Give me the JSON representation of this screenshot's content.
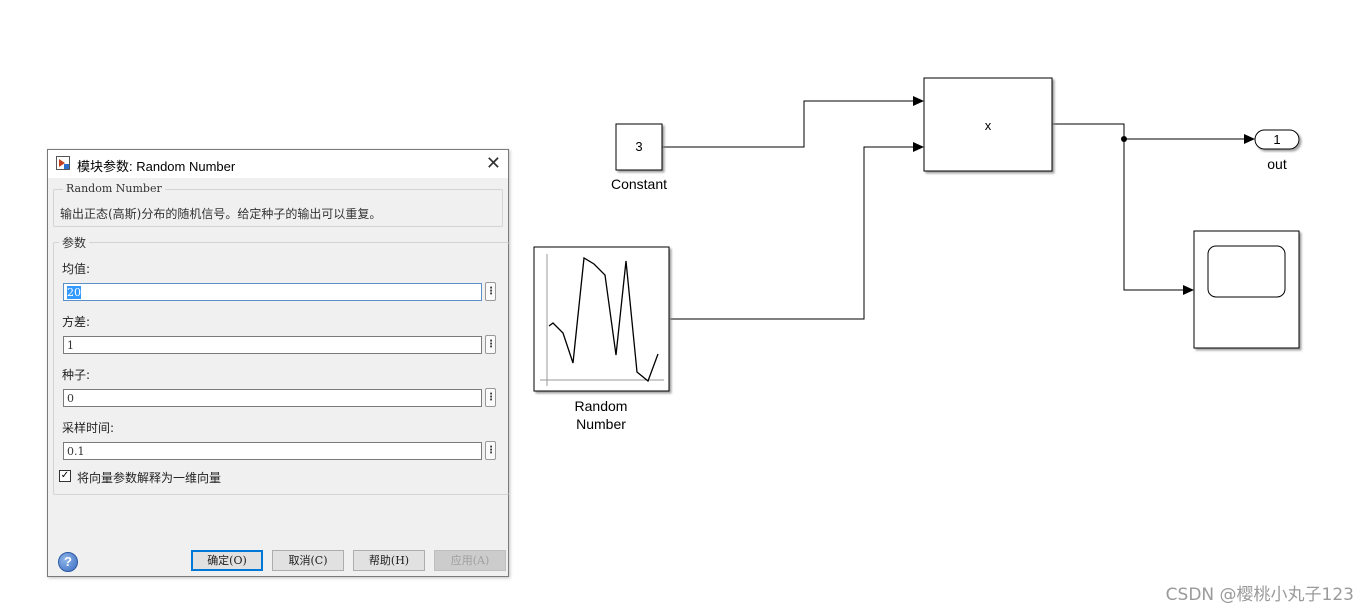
{
  "diagram": {
    "constant": {
      "value": "3",
      "label": "Constant"
    },
    "product": {
      "symbol": "x"
    },
    "random_number": {
      "label_line1": "Random",
      "label_line2": "Number"
    },
    "outport": {
      "number": "1",
      "label": "out"
    }
  },
  "dialog": {
    "title": "模块参数: Random Number",
    "block_group_title": "Random Number",
    "description": "输出正态(高斯)分布的随机信号。给定种子的输出可以重复。",
    "params_group_title": "参数",
    "params": [
      {
        "label": "均值:",
        "value": "20"
      },
      {
        "label": "方差:",
        "value": "1"
      },
      {
        "label": "种子:",
        "value": "0"
      },
      {
        "label": "采样时间:",
        "value": "0.1"
      }
    ],
    "checkbox": {
      "label": "将向量参数解释为一维向量",
      "checked": true
    },
    "buttons": {
      "ok": "确定(O)",
      "cancel": "取消(C)",
      "help": "帮助(H)",
      "apply": "应用(A)"
    },
    "help_icon_glyph": "?",
    "close_glyph": "✕",
    "more_glyph": "⋮"
  },
  "watermark": "CSDN @樱桃小丸子123"
}
